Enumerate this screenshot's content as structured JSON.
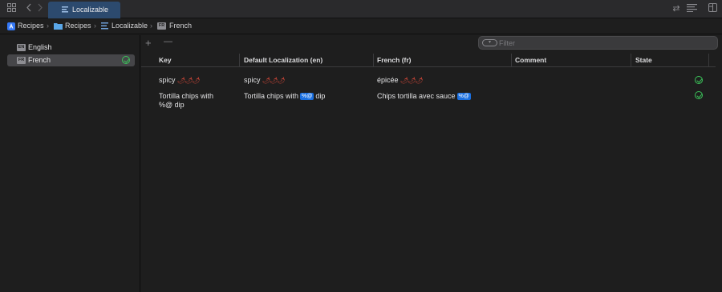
{
  "tabs": [
    {
      "label": "Localizable",
      "active": true
    }
  ],
  "breadcrumb": [
    {
      "label": "Recipes",
      "icon": "app-icon"
    },
    {
      "label": "Recipes",
      "icon": "folder-icon"
    },
    {
      "label": "Localizable",
      "icon": "string-catalog-icon"
    },
    {
      "label": "French",
      "icon": "language-badge",
      "badge": "FR"
    }
  ],
  "sidebar": {
    "languages": [
      {
        "code": "EN",
        "label": "English",
        "selected": false,
        "complete": false
      },
      {
        "code": "FR",
        "label": "French",
        "selected": true,
        "complete": true
      }
    ]
  },
  "toolbar": {
    "add_label": "+",
    "remove_label": "—",
    "filter_placeholder": "Filter"
  },
  "table": {
    "columns": [
      "Key",
      "Default Localization (en)",
      "French (fr)",
      "Comment",
      "State"
    ],
    "rows": [
      {
        "key": "spicy",
        "key_emoji": "🌶🌶🌶",
        "default": "spicy",
        "default_emoji": "🌶🌶🌶",
        "french": "épicée",
        "french_emoji": "🌶🌶🌶",
        "comment": "",
        "state": "translated"
      },
      {
        "key_line1": "Tortilla chips with",
        "key_line2": "%@ dip",
        "default_before": "Tortilla chips with",
        "default_placeholder": "%@",
        "default_after": "dip",
        "french_before": "Chips tortilla avec sauce",
        "french_placeholder": "%@",
        "comment": "",
        "state": "translated"
      }
    ]
  },
  "colors": {
    "accent": "#2c4a6e",
    "check": "#3bc45a",
    "placeholder_token": "#1a6fe0"
  }
}
